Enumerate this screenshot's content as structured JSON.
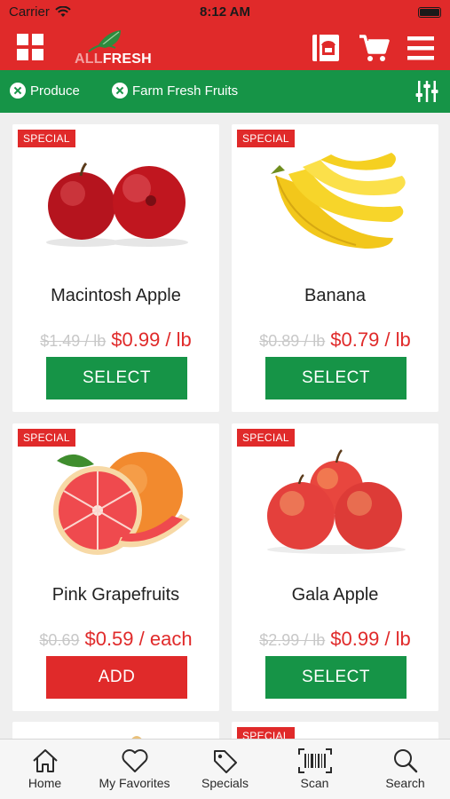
{
  "status": {
    "carrier": "Carrier",
    "time": "8:12 AM"
  },
  "header": {
    "logo_all": "ALL",
    "logo_fresh": "FRESH",
    "icons": [
      "grid-icon",
      "store-icon",
      "cart-icon",
      "menu-icon"
    ]
  },
  "filters": {
    "chips": [
      {
        "label": "Produce"
      },
      {
        "label": "Farm Fresh Fruits"
      }
    ],
    "icon": "sliders-icon"
  },
  "products": [
    {
      "badge": "SPECIAL",
      "name": "Macintosh Apple",
      "old_price": "$1.49 / lb",
      "price": "$0.99 / lb",
      "button": "SELECT",
      "button_color": "#169447"
    },
    {
      "badge": "SPECIAL",
      "name": "Banana",
      "old_price": "$0.89 / lb",
      "price": "$0.79 / lb",
      "button": "SELECT",
      "button_color": "#169447"
    },
    {
      "badge": "SPECIAL",
      "name": "Pink Grapefruits",
      "old_price": "$0.69",
      "price": "$0.59 / each",
      "button": "ADD",
      "button_color": "#e02a2a"
    },
    {
      "badge": "SPECIAL",
      "name": "Gala Apple",
      "old_price": "$2.99 / lb",
      "price": "$0.99 / lb",
      "button": "SELECT",
      "button_color": "#169447"
    },
    {
      "badge": "",
      "name": "",
      "old_price": "",
      "price": "",
      "button": ""
    },
    {
      "badge": "SPECIAL",
      "name": "",
      "old_price": "",
      "price": "",
      "button": ""
    }
  ],
  "tabs": [
    {
      "label": "Home",
      "icon": "home-icon"
    },
    {
      "label": "My Favorites",
      "icon": "heart-icon"
    },
    {
      "label": "Specials",
      "icon": "tag-icon"
    },
    {
      "label": "Scan",
      "icon": "barcode-icon"
    },
    {
      "label": "Search",
      "icon": "search-icon"
    }
  ],
  "colors": {
    "brand_red": "#e02a2a",
    "brand_green": "#169447"
  }
}
